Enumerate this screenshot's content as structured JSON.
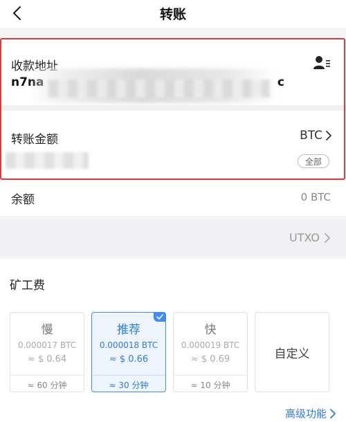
{
  "header": {
    "title": "转账"
  },
  "address": {
    "label": "收款地址",
    "value_start": "n7na",
    "value_end": "c"
  },
  "amount": {
    "label": "转账金额",
    "unit": "BTC",
    "all_label": "全部"
  },
  "balance": {
    "label": "余额",
    "value": "0 BTC"
  },
  "utxo": {
    "label": "UTXO"
  },
  "fee": {
    "title": "矿工费",
    "options": [
      {
        "name": "慢",
        "btc": "0.000017 BTC",
        "usd": "≈ $ 0.64",
        "time": "≈ 60 分钟"
      },
      {
        "name": "推荐",
        "btc": "0.000018 BTC",
        "usd": "≈ $ 0.66",
        "time": "≈ 30 分钟"
      },
      {
        "name": "快",
        "btc": "0.000019 BTC",
        "usd": "≈ $ 0.69",
        "time": "≈ 10 分钟"
      }
    ],
    "custom_label": "自定义",
    "advanced_label": "高级功能"
  },
  "colors": {
    "accent": "#2d7be6",
    "highlight_frame": "#e0393b"
  }
}
